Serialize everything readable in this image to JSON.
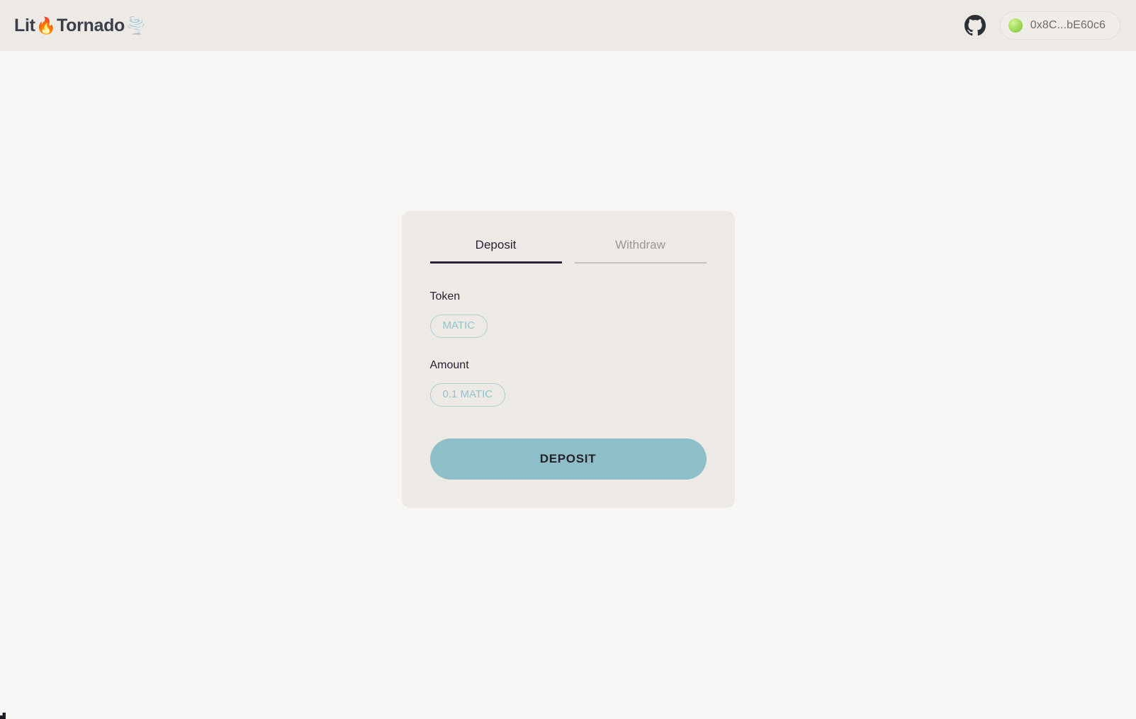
{
  "header": {
    "brand": {
      "text_lead": "Lit",
      "fire_emoji": "🔥",
      "text_mid": "Tornado",
      "tornado_emoji": "🌪️"
    },
    "github_icon": "github-icon",
    "wallet": {
      "status_dot": "connected-status-dot",
      "address": "0x8C...bE60c6"
    }
  },
  "card": {
    "tabs": [
      {
        "label": "Deposit",
        "active": true
      },
      {
        "label": "Withdraw",
        "active": false
      }
    ],
    "fields": [
      {
        "label": "Token",
        "chip_value": "MATIC"
      },
      {
        "label": "Amount",
        "chip_value": "0.1 MATIC"
      }
    ],
    "action_button": "DEPOSIT"
  },
  "colors": {
    "page_background": "#F7F6F4",
    "header_background": "#EDEAE6",
    "card_background": "#EDEAE6",
    "accent_teal": "#8CBFC8",
    "chip_border": "#A9CFD6",
    "chip_text": "#8FC4CD",
    "active_tab_underline": "#2D2135",
    "inactive_tab_underline": "#C7C3BF",
    "text_primary": "#2A1F33",
    "text_muted": "#9B9896",
    "status_green": "#A8E063"
  }
}
